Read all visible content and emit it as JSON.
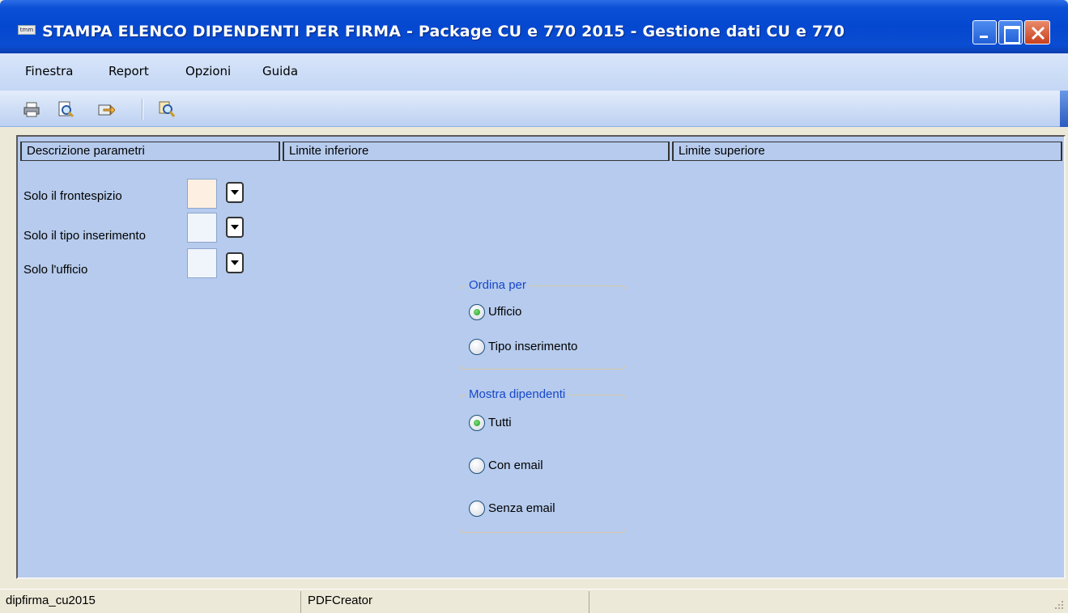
{
  "window": {
    "title": "STAMPA ELENCO DIPENDENTI PER FIRMA - Package CU e 770 2015 - Gestione dati CU e 770",
    "app_icon_text": "tmm"
  },
  "menu": {
    "items": [
      {
        "label": "Finestra"
      },
      {
        "label": "Report"
      },
      {
        "label": "Opzioni"
      },
      {
        "label": "Guida"
      }
    ]
  },
  "toolbar": {
    "icons": [
      "printer-icon",
      "print-preview-icon",
      "export-icon",
      "search-icon"
    ]
  },
  "columns": {
    "headers": [
      "Descrizione parametri",
      "Limite inferiore",
      "Limite superiore"
    ]
  },
  "params": [
    {
      "label": "Solo il frontespizio",
      "value": ""
    },
    {
      "label": "Solo il tipo inserimento",
      "value": ""
    },
    {
      "label": "Solo l'ufficio",
      "value": ""
    }
  ],
  "ordina": {
    "title": "Ordina per",
    "options": [
      {
        "label": "Ufficio",
        "checked": true
      },
      {
        "label": "Tipo inserimento",
        "checked": false
      }
    ]
  },
  "mostra": {
    "title": "Mostra dipendenti",
    "options": [
      {
        "label": "Tutti",
        "checked": true
      },
      {
        "label": "Con email",
        "checked": false
      },
      {
        "label": "Senza email",
        "checked": false
      }
    ]
  },
  "status": {
    "report_name": "dipfirma_cu2015",
    "printer": "PDFCreator"
  },
  "colors": {
    "titlebar": "#0548d0",
    "panel_bg": "#b6cbed",
    "group_title": "#1747c9"
  }
}
